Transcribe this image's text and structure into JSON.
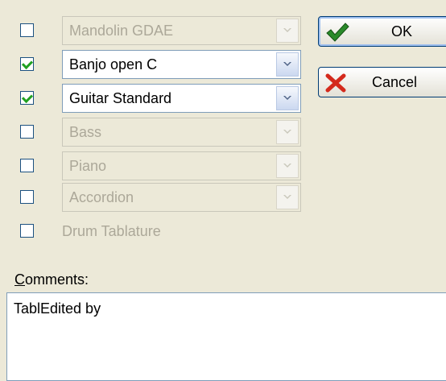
{
  "instruments": [
    {
      "label": "Mandolin GDAE",
      "checked": false,
      "enabled": false
    },
    {
      "label": "Banjo open C",
      "checked": true,
      "enabled": true
    },
    {
      "label": "Guitar Standard",
      "checked": true,
      "enabled": true
    },
    {
      "label": "Bass",
      "checked": false,
      "enabled": false
    },
    {
      "label": "Piano",
      "checked": false,
      "enabled": false
    },
    {
      "label": "Accordion",
      "checked": false,
      "enabled": false
    }
  ],
  "drum": {
    "label": "Drum Tablature",
    "checked": false
  },
  "buttons": {
    "ok_label": "OK",
    "cancel_label": "Cancel"
  },
  "comments": {
    "label_mnemonic": "C",
    "label_rest": "omments:",
    "value": "TablEdited by"
  },
  "icons": {
    "ok": "checkmark-icon",
    "cancel": "x-icon",
    "dropdown": "chevron-down-icon"
  },
  "colors": {
    "check": "#21a121",
    "cancel_x": "#d42a1c",
    "ok_check": "#2a8a2a",
    "disabled_text": "#aca899"
  }
}
